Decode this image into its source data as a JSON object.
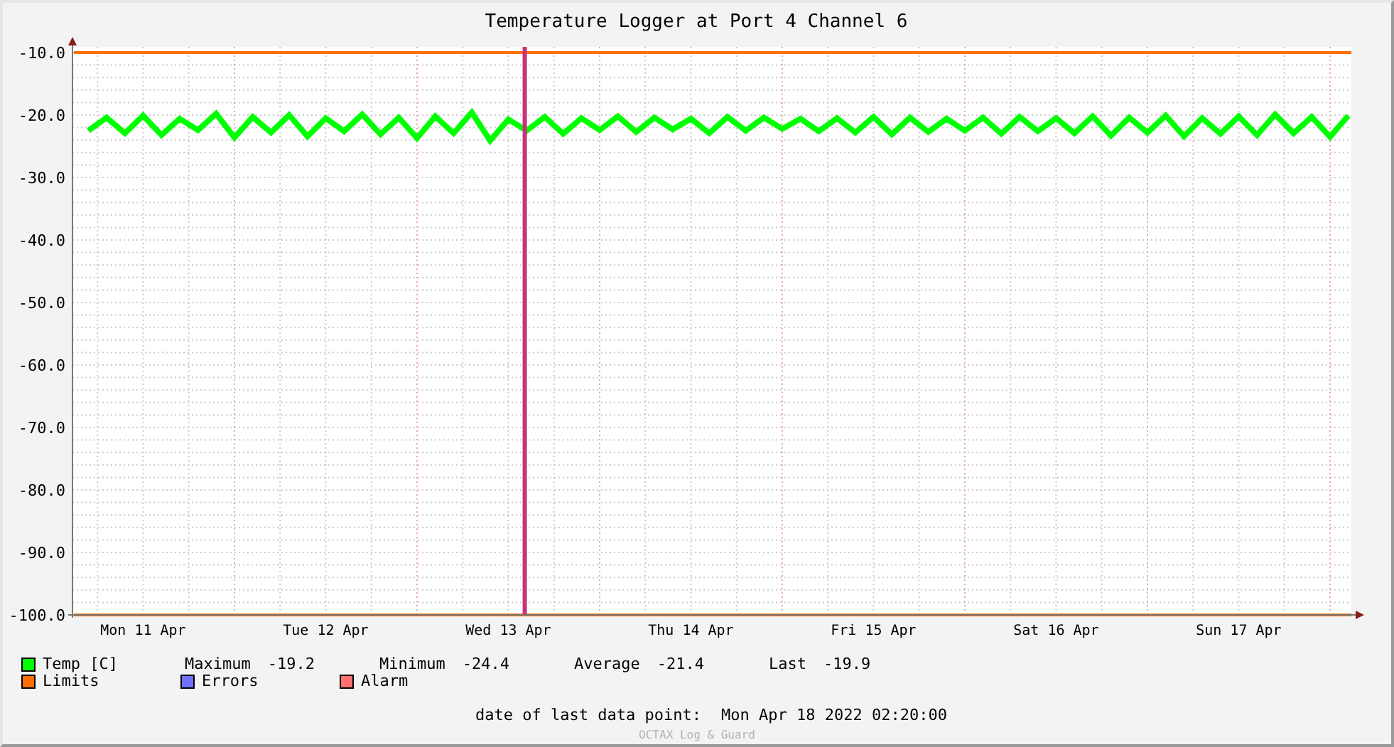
{
  "chart": {
    "chart_data": {
      "type": "line",
      "title": "Temperature Logger at Port 4 Channel 6",
      "grid": true,
      "ylim": [
        -100,
        -10
      ],
      "categories": [
        null,
        null,
        null,
        "Mon 11 Apr",
        null,
        null,
        null,
        null,
        null,
        null,
        null,
        null,
        null,
        "Tue 12 Apr",
        null,
        null,
        null,
        null,
        null,
        null,
        null,
        null,
        null,
        "Wed 13 Apr",
        null,
        null,
        null,
        null,
        null,
        null,
        null,
        null,
        null,
        "Thu 14 Apr",
        null,
        null,
        null,
        null,
        null,
        null,
        null,
        null,
        null,
        "Fri 15 Apr",
        null,
        null,
        null,
        null,
        null,
        null,
        null,
        null,
        null,
        "Sat 16 Apr",
        null,
        null,
        null,
        null,
        null,
        null,
        null,
        null,
        null,
        "Sun 17 Apr",
        null,
        null,
        null,
        null,
        null,
        null
      ],
      "yticks": [
        {
          "value": -10,
          "label": "-10.0"
        },
        {
          "value": -20,
          "label": "-20.0"
        },
        {
          "value": -30,
          "label": "-30.0"
        },
        {
          "value": -40,
          "label": "-40.0"
        },
        {
          "value": -50,
          "label": "-50.0"
        },
        {
          "value": -60,
          "label": "-60.0"
        },
        {
          "value": -70,
          "label": "-70.0"
        },
        {
          "value": -80,
          "label": "-80.0"
        },
        {
          "value": -90,
          "label": "-90.0"
        },
        {
          "value": -100,
          "label": "-100.0"
        }
      ],
      "series": [
        {
          "name": "Temp [C]",
          "color": "#00ff00",
          "values": [
            -22.5,
            -20.4,
            -22.9,
            -20.1,
            -23.2,
            -20.6,
            -22.4,
            -19.8,
            -23.6,
            -20.3,
            -22.8,
            -20.0,
            -23.4,
            -20.5,
            -22.6,
            -19.9,
            -23.1,
            -20.4,
            -23.7,
            -20.2,
            -22.9,
            -19.6,
            -24.1,
            -20.7,
            -22.5,
            -20.3,
            -23.0,
            -20.5,
            -22.4,
            -20.2,
            -22.7,
            -20.4,
            -22.3,
            -20.6,
            -22.9,
            -20.3,
            -22.5,
            -20.4,
            -22.2,
            -20.6,
            -22.6,
            -20.5,
            -22.8,
            -20.3,
            -23.1,
            -20.4,
            -22.7,
            -20.6,
            -22.5,
            -20.4,
            -23.0,
            -20.3,
            -22.6,
            -20.5,
            -22.9,
            -20.2,
            -23.3,
            -20.4,
            -22.8,
            -20.1,
            -23.4,
            -20.5,
            -23.0,
            -20.2,
            -23.2,
            -19.9,
            -22.9,
            -20.3,
            -23.5,
            -20.1
          ]
        }
      ],
      "ref_lines": [
        {
          "axis": "y",
          "value": -10
        },
        {
          "axis": "y",
          "value": -100
        }
      ]
    }
  },
  "legend": {
    "items": [
      {
        "label": "Limits",
        "color": "#ff7000"
      },
      {
        "label": "Errors",
        "color": "#7070ff"
      },
      {
        "label": "Alarm",
        "color": "#ff7070"
      }
    ],
    "stats": [
      {
        "label": "Maximum",
        "value": "-19.2"
      },
      {
        "label": "Minimum",
        "value": "-24.4"
      },
      {
        "label": "Average",
        "value": "-21.4"
      },
      {
        "label": "Last",
        "value": "-19.9"
      }
    ]
  },
  "footer": {
    "label": "date of last data point:",
    "value": "Mon Apr 18 2022 02:20:00",
    "credit": "OCTAX Log & Guard"
  }
}
